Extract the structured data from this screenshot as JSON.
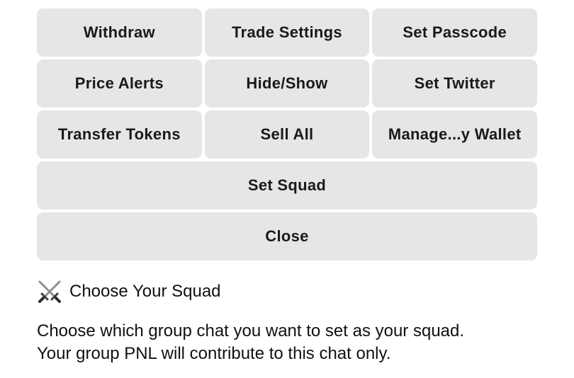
{
  "keyboard": {
    "rows": [
      [
        "Withdraw",
        "Trade Settings",
        "Set Passcode"
      ],
      [
        "Price Alerts",
        "Hide/Show",
        "Set Twitter"
      ],
      [
        "Transfer Tokens",
        "Sell All",
        "Manage...y Wallet"
      ],
      [
        "Set Squad"
      ],
      [
        "Close"
      ]
    ],
    "button_color": "#e6e6e6"
  },
  "message": {
    "icon": "crossed-swords-icon",
    "title": "Choose Your Squad",
    "body_line1": "Choose which group chat you want to set as your squad.",
    "body_line2": "Your group PNL will contribute to this chat only."
  }
}
